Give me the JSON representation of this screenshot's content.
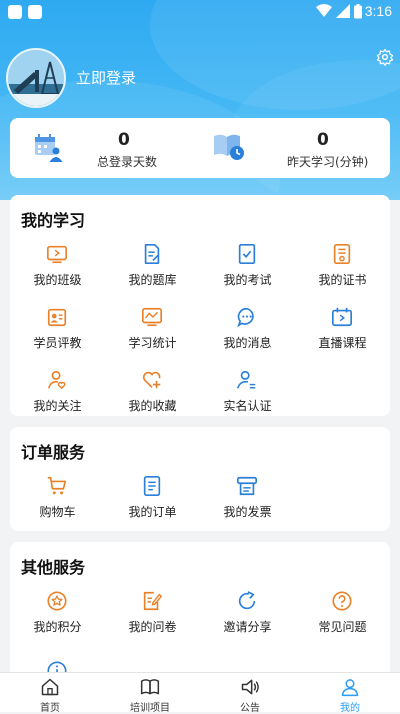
{
  "status_bar": {
    "time": "3:16"
  },
  "profile": {
    "login_text": "立即登录"
  },
  "stats": [
    {
      "value": "0",
      "label": "总登录天数"
    },
    {
      "value": "0",
      "label": "昨天学习(分钟)"
    }
  ],
  "my_study": {
    "title": "我的学习",
    "items": [
      {
        "label": "我的班级",
        "icon": "class-icon"
      },
      {
        "label": "我的题库",
        "icon": "question-bank-icon"
      },
      {
        "label": "我的考试",
        "icon": "exam-icon"
      },
      {
        "label": "我的证书",
        "icon": "certificate-icon"
      },
      {
        "label": "学员评教",
        "icon": "evaluation-icon"
      },
      {
        "label": "学习统计",
        "icon": "statistics-icon"
      },
      {
        "label": "我的消息",
        "icon": "message-icon"
      },
      {
        "label": "直播课程",
        "icon": "live-icon"
      },
      {
        "label": "我的关注",
        "icon": "follow-icon"
      },
      {
        "label": "我的收藏",
        "icon": "favorite-icon"
      },
      {
        "label": "实名认证",
        "icon": "verify-icon"
      }
    ]
  },
  "order_service": {
    "title": "订单服务",
    "items": [
      {
        "label": "购物车",
        "icon": "cart-icon"
      },
      {
        "label": "我的订单",
        "icon": "order-icon"
      },
      {
        "label": "我的发票",
        "icon": "invoice-icon"
      }
    ]
  },
  "other_service": {
    "title": "其他服务",
    "items": [
      {
        "label": "我的积分",
        "icon": "points-icon"
      },
      {
        "label": "我的问卷",
        "icon": "survey-icon"
      },
      {
        "label": "邀请分享",
        "icon": "share-icon"
      },
      {
        "label": "常见问题",
        "icon": "faq-icon"
      }
    ]
  },
  "tabbar": [
    {
      "label": "首页",
      "icon": "home-icon"
    },
    {
      "label": "培训项目",
      "icon": "training-icon"
    },
    {
      "label": "公告",
      "icon": "announcement-icon"
    },
    {
      "label": "我的",
      "icon": "profile-icon"
    }
  ],
  "colors": {
    "brand_blue": "#2ea9f1",
    "icon_orange": "#e8822a",
    "icon_blue": "#2a7fd8",
    "active_tab": "#2a9df4"
  }
}
